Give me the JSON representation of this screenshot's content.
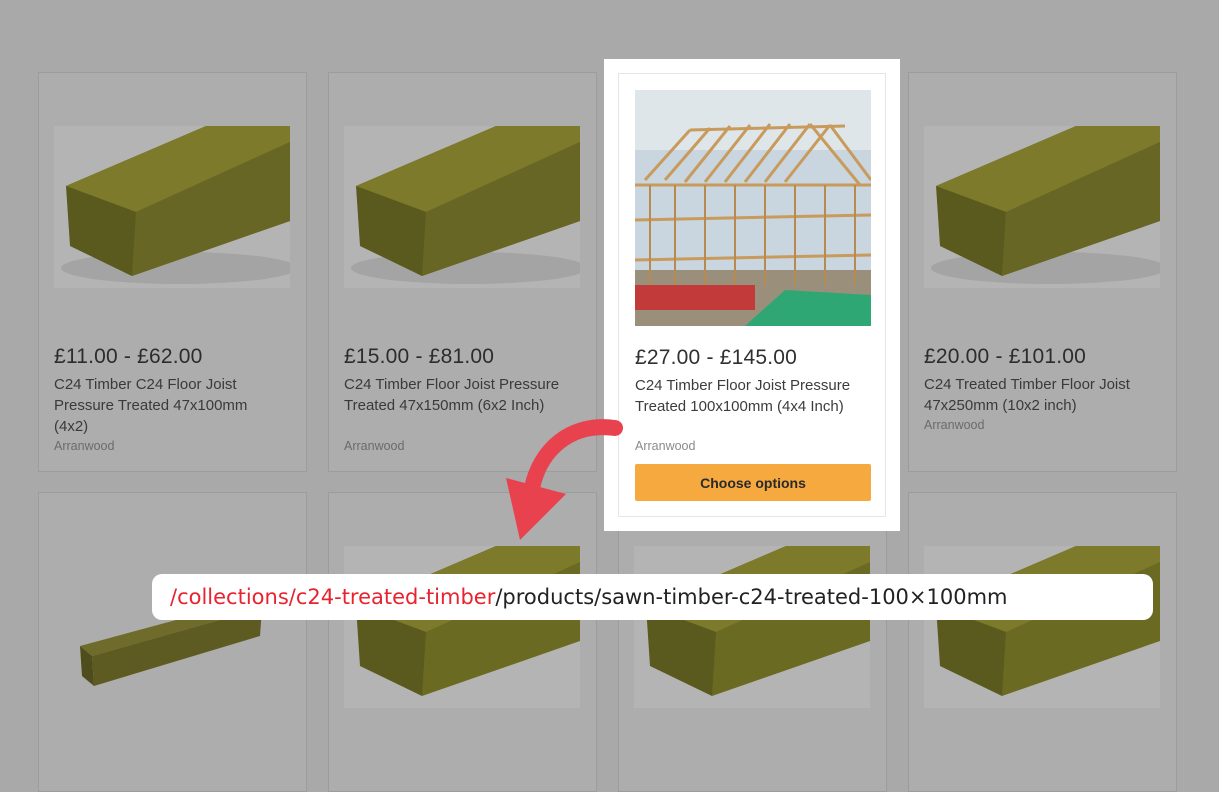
{
  "products": [
    {
      "price": "£11.00 - £62.00",
      "title": "C24 Timber C24 Floor Joist Pressure Treated 47x100mm (4x2)",
      "vendor": "Arranwood"
    },
    {
      "price": "£15.00 - £81.00",
      "title": "C24 Timber Floor Joist Pressure Treated 47x150mm (6x2 Inch)",
      "vendor": "Arranwood"
    },
    {
      "price": "£27.00 - £145.00",
      "title": "C24 Timber Floor Joist Pressure Treated 100x100mm (4x4 Inch)",
      "vendor": "Arranwood",
      "button": "Choose options"
    },
    {
      "price": "£20.00 - £101.00",
      "title": "C24 Treated Timber Floor Joist 47x250mm (10x2 inch)",
      "vendor": "Arranwood"
    }
  ],
  "url": {
    "collection_part": "/collections/c24-treated-timber",
    "product_part": "/products/sawn-timber-c24-treated-100×100mm"
  },
  "colors": {
    "overlay": "#a9a9a9",
    "button": "#f5a93f",
    "url_highlight": "#e8232f",
    "arrow": "#e8424f"
  },
  "icons": {
    "arrow": "curved-arrow-icon"
  }
}
